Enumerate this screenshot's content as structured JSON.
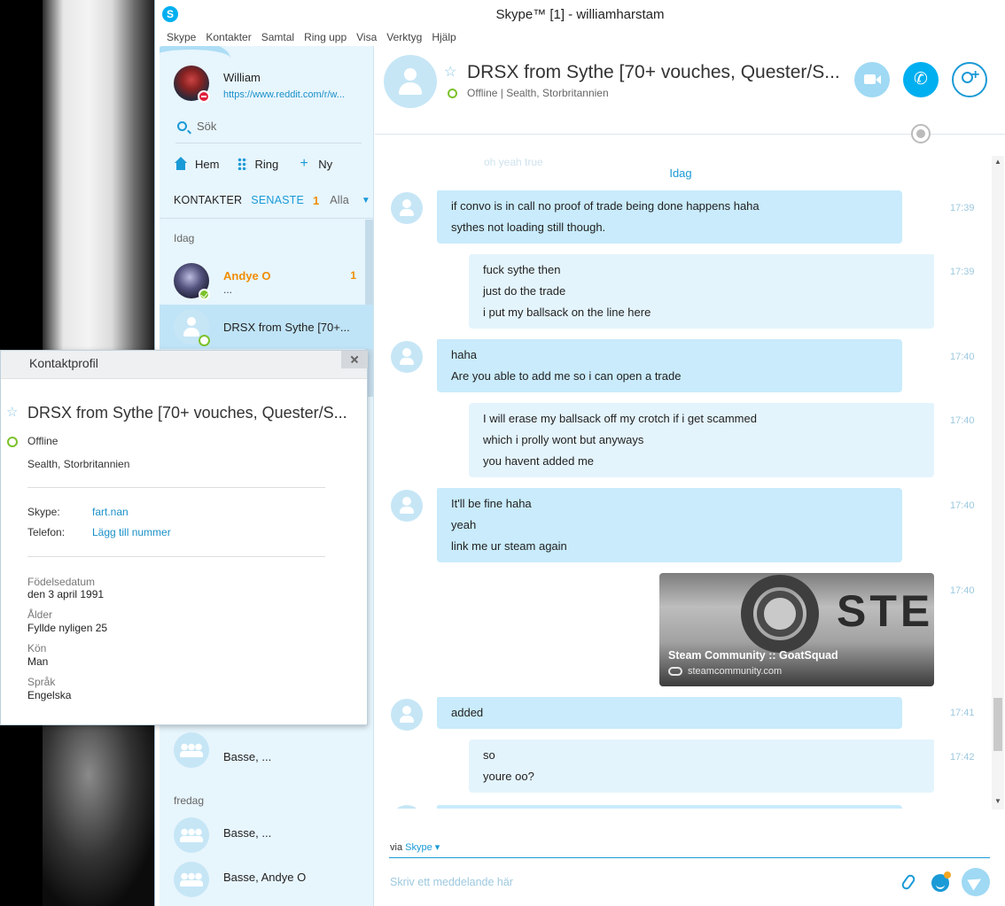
{
  "window": {
    "title": "Skype™ [1] - williamharstam",
    "logo": "S"
  },
  "menu": [
    "Skype",
    "Kontakter",
    "Samtal",
    "Ring upp",
    "Visa",
    "Verktyg",
    "Hjälp"
  ],
  "profile": {
    "name": "William",
    "mood": "https://www.reddit.com/r/w...",
    "status": "do-not-disturb"
  },
  "search": {
    "label": "Sök"
  },
  "actions": {
    "home": "Hem",
    "call": "Ring",
    "new": "Ny"
  },
  "tabs": {
    "contacts": "KONTAKTER",
    "recent": "SENASTE",
    "recent_count": "1",
    "filter": "Alla"
  },
  "recent": {
    "group_today": "Idag",
    "andy": {
      "name": "Andye O",
      "preview": "...",
      "badge": "1"
    },
    "drsx": {
      "name": "DRSX from Sythe [70+..."
    },
    "basse1": {
      "name": "Basse, ..."
    },
    "group_friday": "fredag",
    "basse2": {
      "name": "Basse, ..."
    },
    "basse3": {
      "name": "Basse, Andye O"
    }
  },
  "chat": {
    "name": "DRSX from Sythe [70+ vouches, Quester/S...",
    "status_line": "Offline  |  Sealth, Storbritannien",
    "ghost_text": "oh yeah true",
    "day_label": "Idag",
    "messages": [
      {
        "lines": [
          "if convo is in call no proof of trade being done happens haha",
          "sythes not loading still though."
        ],
        "time": "17:39"
      },
      {
        "lines": [
          "fuck sythe then",
          "just do the trade",
          "i put my ballsack on the line here"
        ],
        "time": "17:39"
      },
      {
        "lines": [
          "haha",
          "Are you able to add me so i can open a trade"
        ],
        "time": "17:40"
      },
      {
        "lines": [
          "I will erase my ballsack off my crotch if i get scammed",
          "which i prolly wont but anyways",
          "you havent added me"
        ],
        "time": "17:40"
      },
      {
        "lines": [
          "It'll be fine haha",
          "yeah",
          "link me ur steam again"
        ],
        "time": "17:40"
      },
      {
        "time": "17:40"
      },
      {
        "lines": [
          "added"
        ],
        "time": "17:41"
      },
      {
        "lines": [
          "so",
          "youre oo?"
        ],
        "time": "17:42"
      }
    ],
    "card": {
      "title": "Steam Community :: GoatSquad",
      "domain": "steamcommunity.com",
      "logo_text": "STE"
    },
    "compose": {
      "via": "via",
      "via_service": "Skype ▾",
      "placeholder": "Skriv ett meddelande här"
    }
  },
  "popup": {
    "title": "Kontaktprofil",
    "name": "DRSX from Sythe [70+ vouches, Quester/S...",
    "status": "Offline",
    "location": "Sealth, Storbritannien",
    "skype_label": "Skype:",
    "skype_value": "fart.nan",
    "phone_label": "Telefon:",
    "phone_value": "Lägg till nummer",
    "birthday_label": "Födelsedatum",
    "birthday_value": "den 3 april 1991",
    "age_label": "Ålder",
    "age_value": "Fyllde nyligen 25",
    "gender_label": "Kön",
    "gender_value": "Man",
    "language_label": "Språk",
    "language_value": "Engelska"
  },
  "colors": {
    "accent": "#00aff0",
    "link": "#1a90c8",
    "unread": "#f08d00",
    "online": "#7cc22b",
    "incoming_bubble": "#c9ebfb",
    "outgoing_bubble": "#e4f4fc"
  }
}
